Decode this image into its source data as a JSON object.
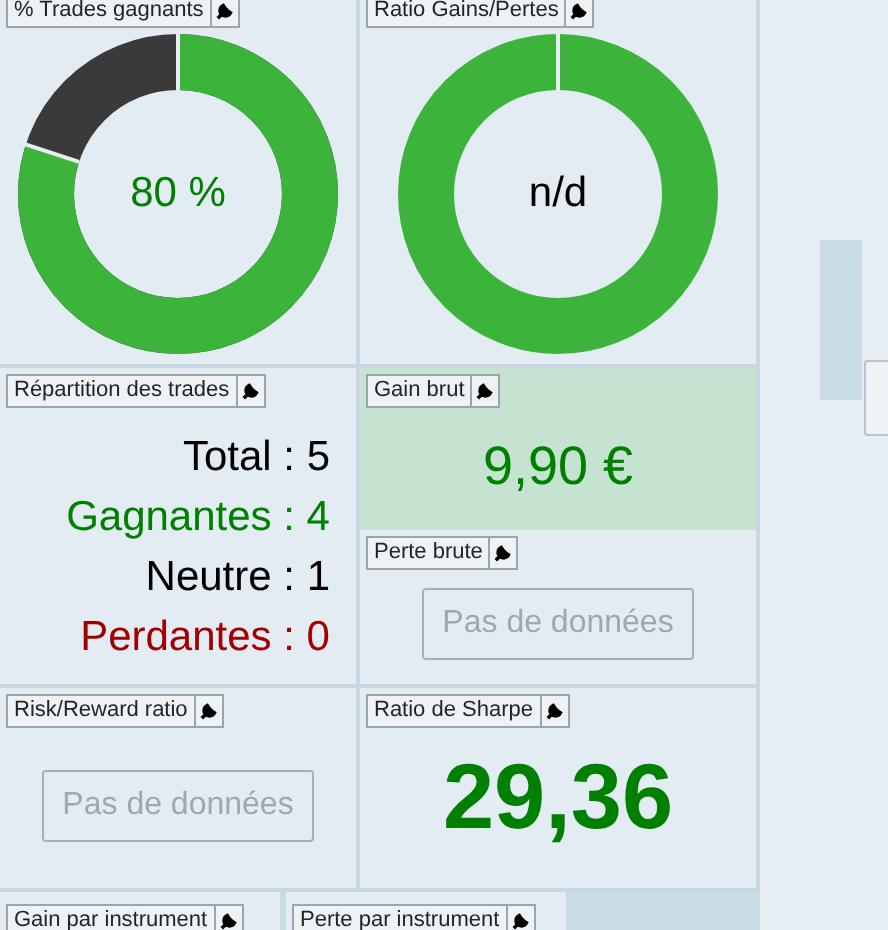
{
  "cells": [
    {
      "widgets": [
        {
          "kind": "donut",
          "title": "% Trades gagnants",
          "level": 0.8,
          "value": "80 %",
          "color": "#008000"
        }
      ]
    },
    {
      "widgets": [
        {
          "kind": "donut",
          "title": "Ratio Gains/Pertes",
          "level": 1,
          "value": "n/d",
          "color": "#000000"
        }
      ]
    },
    {
      "widgets": [
        {
          "kind": "stats",
          "title": "Répartition des trades",
          "lines": [
            {
              "text": "Total : 5",
              "color": "#000000"
            },
            {
              "text": "Gagnantes : 4",
              "color": "#008000"
            },
            {
              "text": "Neutre : 1",
              "color": "#000000"
            },
            {
              "text": "Perdantes : 0",
              "color": "#a00000"
            }
          ]
        }
      ]
    },
    {
      "widgets": [
        {
          "kind": "amount",
          "title": "Gain brut",
          "highlighted": true,
          "value": "9,90 €"
        },
        {
          "kind": "empty",
          "title": "Perte brute",
          "message": "Pas de données",
          "disabled": true
        }
      ]
    },
    {
      "widgets": [
        {
          "kind": "empty",
          "title": "Risk/Reward ratio",
          "message": "Pas de données",
          "disabled": true
        }
      ]
    },
    {
      "widgets": [
        {
          "kind": "ratio",
          "title": "Ratio de Sharpe",
          "value": "29,36"
        }
      ]
    }
  ],
  "bottom_widgets": [
    {
      "title": "Gain par instrument"
    },
    {
      "title": "Perte par instrument"
    }
  ]
}
